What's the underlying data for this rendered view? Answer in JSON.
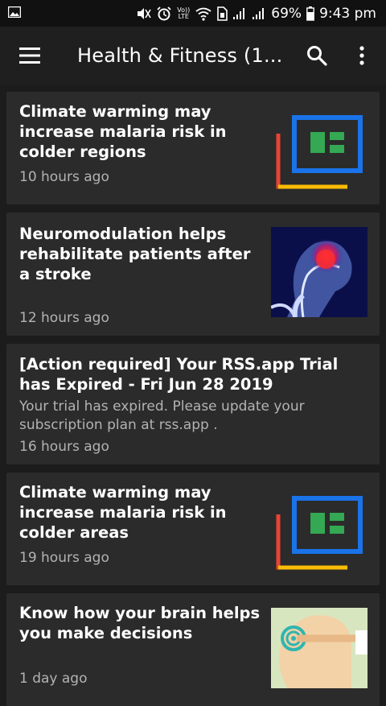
{
  "status_bar": {
    "battery": "69%",
    "time": "9:43 pm",
    "volte": "Vo)) LTE"
  },
  "app_bar": {
    "title": "Health & Fitness (1..."
  },
  "articles": [
    {
      "title": "Climate warming may increase malaria risk in colder regions",
      "time": "10 hours ago",
      "thumbnail": "feed-placeholder-icon"
    },
    {
      "title": "Neuromodulation helps rehabilitate patients after a stroke",
      "time": "12 hours ago",
      "thumbnail": "brain-xray-image"
    },
    {
      "title": "[Action required] Your RSS.app Trial has Expired - Fri Jun 28 2019",
      "description": "Your trial has expired. Please update your subscription plan at rss.app .",
      "time": "16 hours ago"
    },
    {
      "title": "Climate warming may increase malaria risk in colder areas",
      "time": "19 hours ago",
      "thumbnail": "feed-placeholder-icon"
    },
    {
      "title": "Know how your brain helps you make decisions",
      "time": "1 day ago",
      "thumbnail": "brain-decision-illustration"
    }
  ],
  "colors": {
    "placeholder_blue": "#1a73e8",
    "placeholder_green": "#34a853",
    "placeholder_red": "#ea4335",
    "placeholder_yellow": "#fbbc04"
  }
}
